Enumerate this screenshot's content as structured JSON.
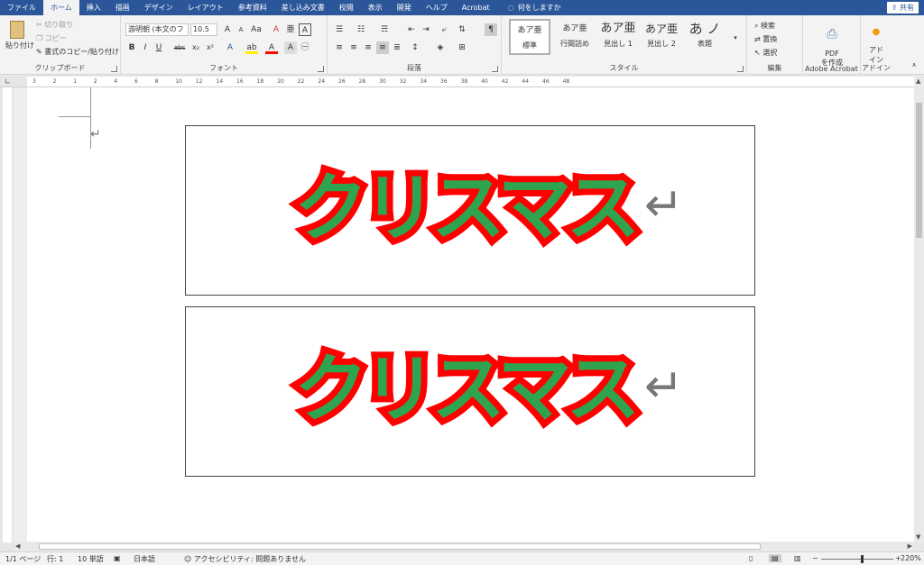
{
  "tabs": [
    "ファイル",
    "ホーム",
    "挿入",
    "描画",
    "デザイン",
    "レイアウト",
    "参考資料",
    "差し込み文書",
    "校閲",
    "表示",
    "開発",
    "ヘルプ",
    "Acrobat"
  ],
  "active_tab": "ホーム",
  "tell_me": "何をしますか",
  "share": "共有",
  "clipboard": {
    "paste": "貼り付け",
    "cut": "切り取り",
    "copy": "コピー",
    "format_painter": "書式のコピー/貼り付け",
    "label": "クリップボード"
  },
  "font": {
    "name": "游明朝 (本文のフ",
    "size": "10.5",
    "label": "フォント"
  },
  "paragraph": {
    "label": "段落"
  },
  "styles": {
    "items": [
      {
        "preview": "あア亜",
        "name": "標準"
      },
      {
        "preview": "あア亜",
        "name": "行間詰め"
      },
      {
        "preview": "あア亜",
        "name": "見出し 1"
      },
      {
        "preview": "あア亜",
        "name": "見出し 2"
      },
      {
        "preview": "あ ノ",
        "name": "表題"
      }
    ],
    "label": "スタイル"
  },
  "editing": {
    "find": "検索",
    "replace": "置換",
    "select": "選択",
    "label": "編集"
  },
  "acrobat": {
    "create_pdf": "PDF\nを作成",
    "label": "Adobe Acrobat"
  },
  "addin": {
    "btn": "アド\nイン",
    "label": "アドイン"
  },
  "document": {
    "wordart_1": "クリスマス",
    "wordart_2": "クリスマス",
    "return_mark": "↵"
  },
  "ruler_numbers": [
    "3",
    "2",
    "1",
    "2",
    "4",
    "6",
    "8",
    "10",
    "12",
    "14",
    "16",
    "18",
    "20",
    "22",
    "24",
    "26",
    "28",
    "30",
    "32",
    "34",
    "36",
    "38",
    "40",
    "42",
    "44",
    "46",
    "48"
  ],
  "status": {
    "page": "1/1 ページ",
    "line": "行: 1",
    "words": "10 単語",
    "language": "日本語",
    "accessibility": "アクセシビリティ: 問題ありません",
    "zoom": "220%"
  }
}
